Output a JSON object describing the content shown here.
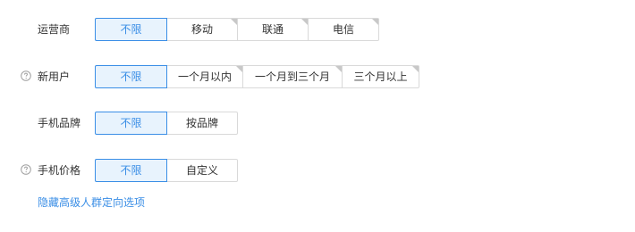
{
  "filters": [
    {
      "label": "运营商",
      "help_icon": false,
      "options": [
        {
          "text": "不限",
          "selected": true,
          "corner": false
        },
        {
          "text": "移动",
          "selected": false,
          "corner": true
        },
        {
          "text": "联通",
          "selected": false,
          "corner": true
        },
        {
          "text": "电信",
          "selected": false,
          "corner": true
        }
      ]
    },
    {
      "label": "新用户",
      "help_icon": true,
      "options": [
        {
          "text": "不限",
          "selected": true,
          "corner": false
        },
        {
          "text": "一个月以内",
          "selected": false,
          "corner": true
        },
        {
          "text": "一个月到三个月",
          "selected": false,
          "corner": true
        },
        {
          "text": "三个月以上",
          "selected": false,
          "corner": true
        }
      ]
    },
    {
      "label": "手机品牌",
      "help_icon": false,
      "options": [
        {
          "text": "不限",
          "selected": true,
          "corner": false
        },
        {
          "text": "按品牌",
          "selected": false,
          "corner": false
        }
      ]
    },
    {
      "label": "手机价格",
      "help_icon": true,
      "options": [
        {
          "text": "不限",
          "selected": true,
          "corner": false
        },
        {
          "text": "自定义",
          "selected": false,
          "corner": false
        }
      ]
    }
  ],
  "advanced_link": "隐藏高级人群定向选项",
  "icons": {
    "help": "question-circle-icon",
    "corner": "corner-triangle-icon"
  },
  "colors": {
    "accent": "#3a8ee6",
    "selected_bg": "#e8f3fd",
    "border": "#d9d9d9",
    "text": "#333333",
    "corner_mark": "#c8c8c8",
    "help_icon": "#a0a0a0"
  }
}
